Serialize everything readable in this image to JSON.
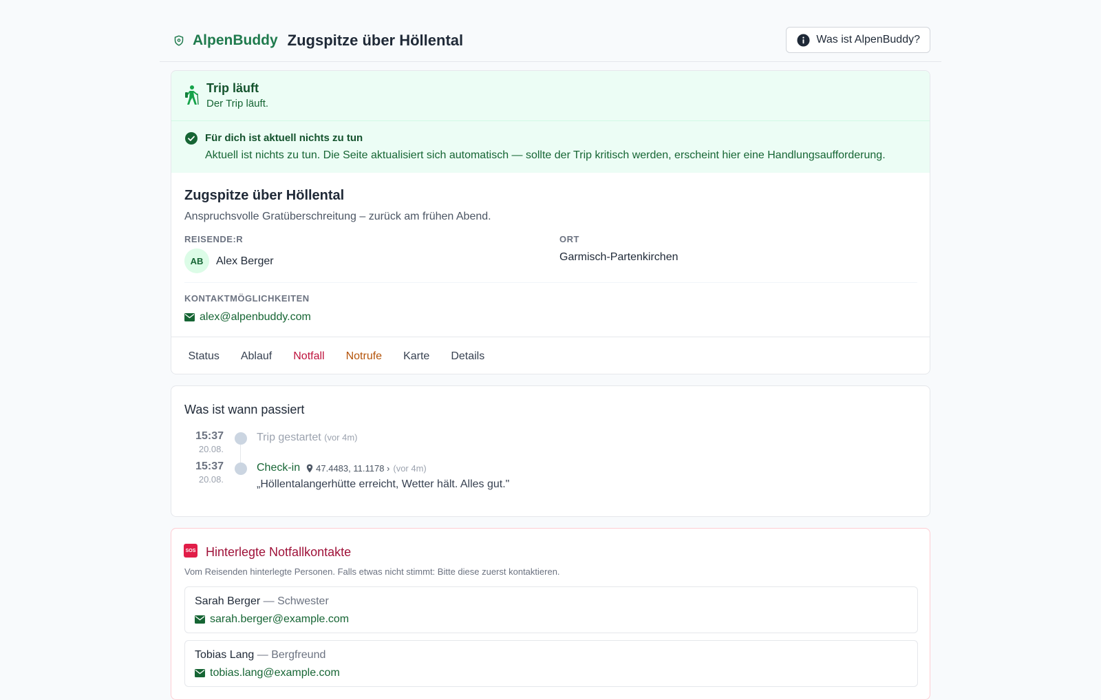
{
  "header": {
    "brand": "AlpenBuddy",
    "title": "Zugspitze über Höllental",
    "info_button": "Was ist AlpenBuddy?"
  },
  "status": {
    "title": "Trip läuft",
    "subtitle": "Der Trip läuft."
  },
  "notice": {
    "title": "Für dich ist aktuell nichts zu tun",
    "text": "Aktuell ist nichts zu tun. Die Seite aktualisiert sich automatisch — sollte der Trip kritisch werden, erscheint hier eine Handlungsaufforderung."
  },
  "trip": {
    "name": "Zugspitze über Höllental",
    "description": "Anspruchsvolle Gratüberschreitung – zurück am frühen Abend.",
    "traveler_label": "REISENDE:R",
    "traveler_initials": "AB",
    "traveler_name": "Alex Berger",
    "place_label": "ORT",
    "place": "Garmisch-Partenkirchen",
    "contact_label": "KONTAKTMÖGLICHKEITEN",
    "contact_email": "alex@alpenbuddy.com"
  },
  "tabs": [
    {
      "label": "Status",
      "color": "#374151"
    },
    {
      "label": "Ablauf",
      "color": "#374151"
    },
    {
      "label": "Notfall",
      "color": "#be123c"
    },
    {
      "label": "Notrufe",
      "color": "#b45309"
    },
    {
      "label": "Karte",
      "color": "#374151"
    },
    {
      "label": "Details",
      "color": "#374151"
    }
  ],
  "timeline": {
    "title": "Was ist wann passiert",
    "events": [
      {
        "time": "15:37",
        "date": "20.08.",
        "name": "Trip gestartet",
        "ago": "(vor 4m)"
      },
      {
        "time": "15:37",
        "date": "20.08.",
        "name": "Check-in",
        "coords": "47.4483, 11.1178 ›",
        "ago": "(vor 4m)",
        "message": "„Höllentalangerhütte erreicht, Wetter hält. Alles gut.\""
      }
    ]
  },
  "emergency": {
    "icon_text": "SOS",
    "title": "Hinterlegte Notfallkontakte",
    "description": "Vom Reisenden hinterlegte Personen. Falls etwas nicht stimmt: Bitte diese zuerst kontaktieren.",
    "contacts": [
      {
        "name": "Sarah Berger",
        "relation": "— Schwester",
        "email": "sarah.berger@example.com"
      },
      {
        "name": "Tobias Lang",
        "relation": "— Bergfreund",
        "email": "tobias.lang@example.com"
      }
    ]
  },
  "colors": {
    "brand_green": "#1f7a4d",
    "alert_red": "#be123c",
    "warning_orange": "#b45309"
  }
}
